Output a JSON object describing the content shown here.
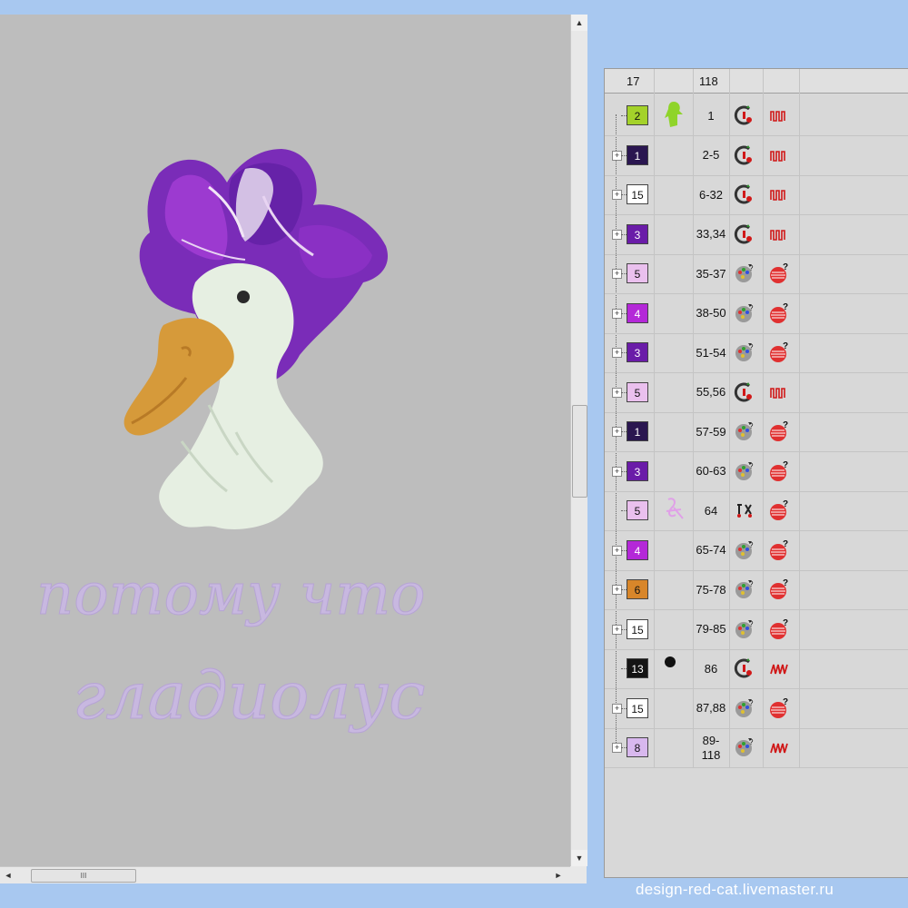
{
  "panel": {
    "header_col1": "17",
    "header_col3": "118",
    "rows": [
      {
        "color": "2",
        "range": "1",
        "fill": "#a4d22a",
        "text": "#111",
        "icon1": "outline-stitch-icon",
        "icon2": "running-stitch-icon",
        "tree": "shape-preview-green"
      },
      {
        "color": "1",
        "range": "2-5",
        "fill": "#2a1650",
        "text": "#fff",
        "icon1": "outline-stitch-icon",
        "icon2": "running-stitch-icon"
      },
      {
        "color": "15",
        "range": "6-32",
        "fill": "#ffffff",
        "text": "#111",
        "icon1": "outline-stitch-icon",
        "icon2": "running-stitch-icon"
      },
      {
        "color": "3",
        "range": "33,34",
        "fill": "#6a1ca8",
        "text": "#fff",
        "icon1": "outline-stitch-icon",
        "icon2": "running-stitch-icon"
      },
      {
        "color": "5",
        "range": "35-37",
        "fill": "#eac0ee",
        "text": "#111",
        "icon1": "fill-palette-icon",
        "icon2": "satin-ball-icon"
      },
      {
        "color": "4",
        "range": "38-50",
        "fill": "#b428d8",
        "text": "#fff",
        "icon1": "fill-palette-icon",
        "icon2": "satin-ball-icon"
      },
      {
        "color": "3",
        "range": "51-54",
        "fill": "#6a1ca8",
        "text": "#fff",
        "icon1": "fill-palette-icon",
        "icon2": "satin-ball-icon"
      },
      {
        "color": "5",
        "range": "55,56",
        "fill": "#eac0ee",
        "text": "#111",
        "icon1": "outline-stitch-icon",
        "icon2": "running-stitch-icon"
      },
      {
        "color": "1",
        "range": "57-59",
        "fill": "#2a1650",
        "text": "#fff",
        "icon1": "fill-palette-icon",
        "icon2": "satin-ball-icon"
      },
      {
        "color": "3",
        "range": "60-63",
        "fill": "#6a1ca8",
        "text": "#fff",
        "icon1": "fill-palette-icon",
        "icon2": "satin-ball-icon"
      },
      {
        "color": "5",
        "range": "64",
        "fill": "#eac0ee",
        "text": "#111",
        "icon1": "lettering-icon",
        "icon2": "satin-ball-icon",
        "tree": "shape-preview-pink"
      },
      {
        "color": "4",
        "range": "65-74",
        "fill": "#b428d8",
        "text": "#fff",
        "icon1": "fill-palette-icon",
        "icon2": "satin-ball-icon"
      },
      {
        "color": "6",
        "range": "75-78",
        "fill": "#d8862a",
        "text": "#111",
        "icon1": "fill-palette-icon",
        "icon2": "satin-ball-icon"
      },
      {
        "color": "15",
        "range": "79-85",
        "fill": "#ffffff",
        "text": "#111",
        "icon1": "fill-palette-icon",
        "icon2": "satin-ball-icon"
      },
      {
        "color": "13",
        "range": "86",
        "fill": "#141414",
        "text": "#fff",
        "icon1": "outline-stitch-icon",
        "icon2": "zigzag-stitch-icon",
        "tree": "shape-preview-black"
      },
      {
        "color": "15",
        "range": "87,88",
        "fill": "#ffffff",
        "text": "#111",
        "icon1": "fill-palette-icon",
        "icon2": "satin-ball-icon"
      },
      {
        "color": "8",
        "range": "89-\n118",
        "fill": "#d8b8ee",
        "text": "#111",
        "icon1": "fill-palette-icon",
        "icon2": "zigzag-stitch-icon"
      }
    ]
  },
  "canvas": {
    "line1": "потому что",
    "line2": "гладиолус"
  },
  "scrollbar": {
    "up": "▲",
    "down": "▼",
    "left": "◄",
    "right": "►",
    "grip": "III"
  },
  "watermark": "design-red-cat.livemaster.ru"
}
